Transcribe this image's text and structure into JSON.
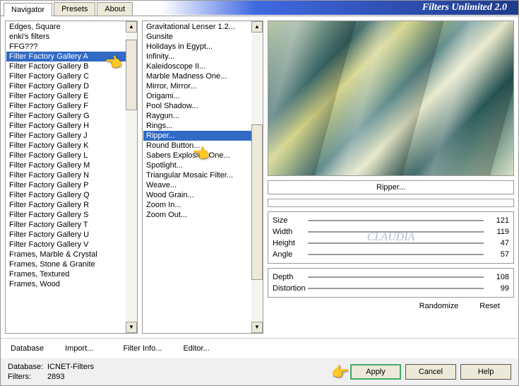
{
  "app_title": "Filters Unlimited 2.0",
  "tabs": [
    "Navigator",
    "Presets",
    "About"
  ],
  "left_list": [
    "Edges, Square",
    "enki's filters",
    "FFG???",
    "Filter Factory Gallery A",
    "Filter Factory Gallery B",
    "Filter Factory Gallery C",
    "Filter Factory Gallery D",
    "Filter Factory Gallery E",
    "Filter Factory Gallery F",
    "Filter Factory Gallery G",
    "Filter Factory Gallery H",
    "Filter Factory Gallery J",
    "Filter Factory Gallery K",
    "Filter Factory Gallery L",
    "Filter Factory Gallery M",
    "Filter Factory Gallery N",
    "Filter Factory Gallery P",
    "Filter Factory Gallery Q",
    "Filter Factory Gallery R",
    "Filter Factory Gallery S",
    "Filter Factory Gallery T",
    "Filter Factory Gallery U",
    "Filter Factory Gallery V",
    "Frames, Marble & Crystal",
    "Frames, Stone & Granite",
    "Frames, Textured",
    "Frames, Wood"
  ],
  "left_selected_index": 3,
  "mid_list": [
    "Gravitational Lenser 1.2...",
    "Gunsite",
    "Holidays in Egypt...",
    "Infinity...",
    "Kaleidoscope II...",
    "Marble Madness One...",
    "Mirror, Mirror...",
    "Origami...",
    "Pool Shadow...",
    "Raygun...",
    "Rings...",
    "Ripper...",
    "Round Button...",
    "Sabers Explosion One...",
    "Spotlight...",
    "Triangular Mosaic Filter...",
    "Weave...",
    "Wood Grain...",
    "Zoom In...",
    "Zoom Out..."
  ],
  "mid_selected_index": 11,
  "current_filter": "Ripper...",
  "sliders1": [
    {
      "label": "Size",
      "value": 121
    },
    {
      "label": "Width",
      "value": 119
    },
    {
      "label": "Height",
      "value": 47
    },
    {
      "label": "Angle",
      "value": 57
    }
  ],
  "sliders2": [
    {
      "label": "Depth",
      "value": 108
    },
    {
      "label": "Distortion",
      "value": 99
    }
  ],
  "watermark": "CLAUDIA",
  "bottom_left": {
    "database": "Database",
    "import": "Import..."
  },
  "bottom_mid": {
    "filter_info": "Filter Info...",
    "editor": "Editor..."
  },
  "right_buttons": {
    "randomize": "Randomize",
    "reset": "Reset"
  },
  "footer": {
    "database_label": "Database:",
    "database_value": "ICNET-Filters",
    "filters_label": "Filters:",
    "filters_value": "2893"
  },
  "buttons": {
    "apply": "Apply",
    "cancel": "Cancel",
    "help": "Help"
  }
}
